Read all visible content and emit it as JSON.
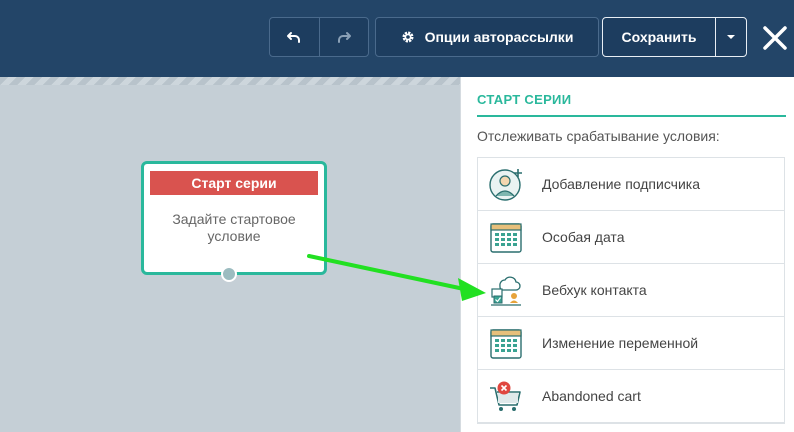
{
  "header": {
    "options_label": "Опции авторассылки",
    "save_label": "Сохранить"
  },
  "node": {
    "title": "Старт серии",
    "body": "Задайте стартовое условие"
  },
  "panel": {
    "title": "СТАРТ СЕРИИ",
    "subtitle": "Отслеживать срабатывание условия:",
    "items": [
      {
        "label": "Добавление подписчика",
        "icon": "add-subscriber-icon"
      },
      {
        "label": "Особая дата",
        "icon": "calendar-icon"
      },
      {
        "label": "Вебхук контакта",
        "icon": "webhook-icon"
      },
      {
        "label": "Изменение переменной",
        "icon": "calendar-icon"
      },
      {
        "label": "Abandoned cart",
        "icon": "cart-icon"
      }
    ]
  },
  "colors": {
    "header": "#234568",
    "accent": "#2ab89c",
    "node_title": "#d9534f",
    "arrow": "#22e022"
  }
}
